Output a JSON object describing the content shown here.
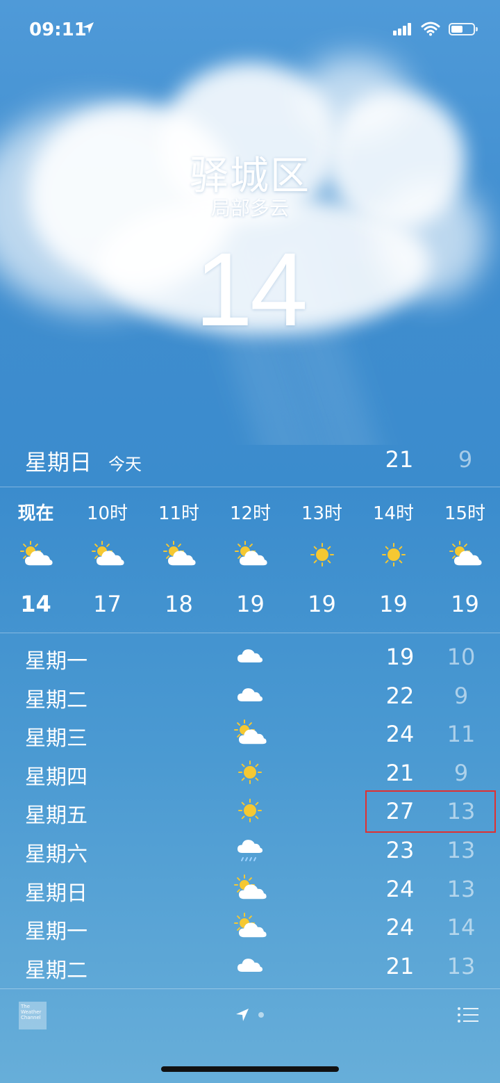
{
  "status_bar": {
    "time": "09:11"
  },
  "header": {
    "city": "驿城区",
    "condition": "局部多云",
    "temperature": "14"
  },
  "today": {
    "day": "星期日",
    "label": "今天",
    "high": "21",
    "low": "9"
  },
  "hourly": [
    {
      "label": "现在",
      "icon": "partly-cloudy",
      "temp": "14",
      "now": true
    },
    {
      "label": "10时",
      "icon": "partly-cloudy",
      "temp": "17"
    },
    {
      "label": "11时",
      "icon": "partly-cloudy",
      "temp": "18"
    },
    {
      "label": "12时",
      "icon": "partly-cloudy",
      "temp": "19"
    },
    {
      "label": "13时",
      "icon": "sunny",
      "temp": "19"
    },
    {
      "label": "14时",
      "icon": "sunny",
      "temp": "19"
    },
    {
      "label": "15时",
      "icon": "partly-cloudy",
      "temp": "19"
    }
  ],
  "daily": [
    {
      "day": "星期一",
      "icon": "cloudy",
      "high": "19",
      "low": "10"
    },
    {
      "day": "星期二",
      "icon": "cloudy",
      "high": "22",
      "low": "9"
    },
    {
      "day": "星期三",
      "icon": "partly-cloudy",
      "high": "24",
      "low": "11"
    },
    {
      "day": "星期四",
      "icon": "sunny",
      "high": "21",
      "low": "9"
    },
    {
      "day": "星期五",
      "icon": "sunny",
      "high": "27",
      "low": "13"
    },
    {
      "day": "星期六",
      "icon": "rain",
      "high": "23",
      "low": "13"
    },
    {
      "day": "星期日",
      "icon": "partly-cloudy",
      "high": "24",
      "low": "13"
    },
    {
      "day": "星期一",
      "icon": "partly-cloudy",
      "high": "24",
      "low": "14"
    },
    {
      "day": "星期二",
      "icon": "cloudy",
      "high": "21",
      "low": "13"
    }
  ],
  "footer": {
    "brand_line1": "The",
    "brand_line2": "Weather",
    "brand_line3": "Channel"
  },
  "colors": {
    "sky_top": "#4f9ad8",
    "sky_bottom": "#67aed9",
    "sun": "#f5c832",
    "highlight": "#e03030"
  }
}
